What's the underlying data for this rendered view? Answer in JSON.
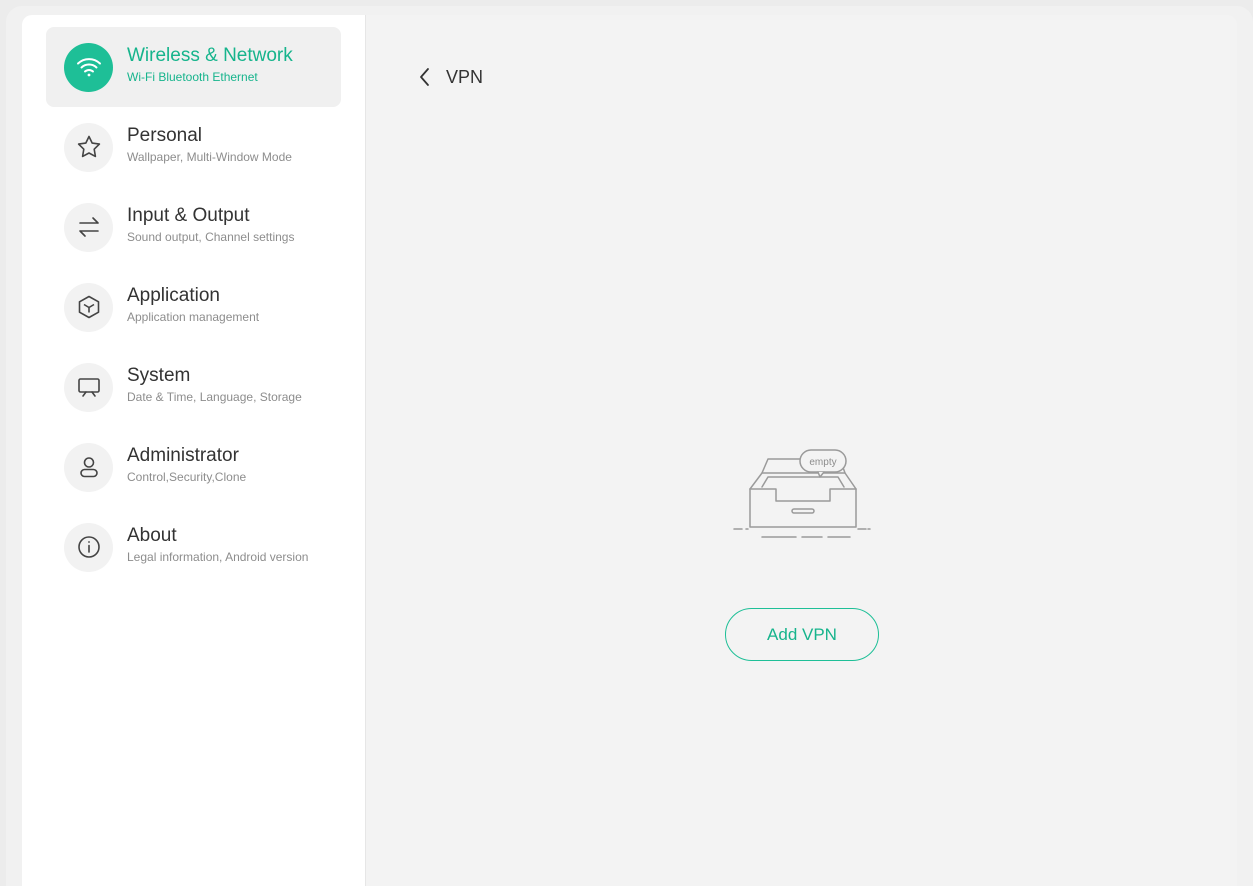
{
  "sidebar": {
    "items": [
      {
        "title": "Wireless & Network",
        "subtitle": "Wi-Fi Bluetooth Ethernet",
        "icon": "wifi-icon",
        "active": true
      },
      {
        "title": "Personal",
        "subtitle": "Wallpaper, Multi-Window Mode",
        "icon": "star-icon"
      },
      {
        "title": "Input & Output",
        "subtitle": "Sound output, Channel settings",
        "icon": "swap-arrows-icon"
      },
      {
        "title": "Application",
        "subtitle": "Application management",
        "icon": "cube-icon"
      },
      {
        "title": "System",
        "subtitle": "Date & Time, Language, Storage",
        "icon": "monitor-icon"
      },
      {
        "title": "Administrator",
        "subtitle": "Control,Security,Clone",
        "icon": "user-icon"
      },
      {
        "title": "About",
        "subtitle": "Legal information, Android version",
        "icon": "info-icon"
      }
    ]
  },
  "main": {
    "title": "VPN",
    "empty_label": "empty",
    "add_button": "Add VPN"
  },
  "colors": {
    "accent": "#1ebf97",
    "accent_text": "#16b48c"
  }
}
